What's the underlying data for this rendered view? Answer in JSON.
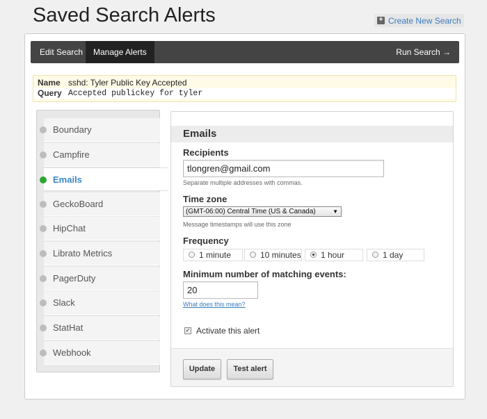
{
  "header": {
    "title": "Saved Search Alerts",
    "create_link": "Create New Search"
  },
  "nav": {
    "tabs": [
      "Edit Search",
      "Manage Alerts"
    ],
    "active_tab": "Manage Alerts",
    "run_search": "Run Search →"
  },
  "search": {
    "name_label": "Name",
    "name_value": "sshd: Tyler Public Key Accepted",
    "query_label": "Query",
    "query_value": "Accepted publickey for tyler"
  },
  "sidebar": {
    "items": [
      {
        "label": "Boundary",
        "active": false
      },
      {
        "label": "Campfire",
        "active": false
      },
      {
        "label": "Emails",
        "active": true
      },
      {
        "label": "GeckoBoard",
        "active": false
      },
      {
        "label": "HipChat",
        "active": false
      },
      {
        "label": "Librato Metrics",
        "active": false
      },
      {
        "label": "PagerDuty",
        "active": false
      },
      {
        "label": "Slack",
        "active": false
      },
      {
        "label": "StatHat",
        "active": false
      },
      {
        "label": "Webhook",
        "active": false
      }
    ]
  },
  "form": {
    "heading": "Emails",
    "recipients_label": "Recipients",
    "recipients_value": "tlongren@gmail.com",
    "recipients_hint": "Separate multiple addresses with commas.",
    "timezone_label": "Time zone",
    "timezone_value": "(GMT-06:00) Central Time (US & Canada)",
    "timezone_hint": "Message timestamps will use this zone",
    "frequency_label": "Frequency",
    "frequency_options": [
      "1 minute",
      "10 minutes",
      "1 hour",
      "1 day"
    ],
    "frequency_selected": "1 hour",
    "min_events_label": "Minimum number of matching events:",
    "min_events_value": "20",
    "min_events_link": "What does this mean?",
    "activate_label": "Activate this alert",
    "activate_checked": true,
    "update_button": "Update",
    "test_button": "Test alert"
  },
  "colors": {
    "nav_bg": "#444444",
    "accent_link": "#3b7bbf",
    "active_dot": "#2fa531"
  }
}
